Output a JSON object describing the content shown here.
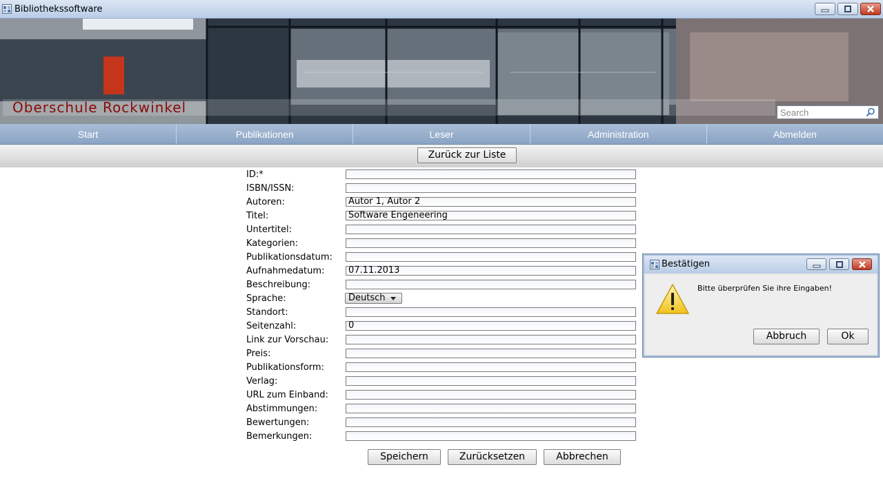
{
  "window": {
    "title": "Bibliothekssoftware"
  },
  "banner": {
    "school_name": "Oberschule Rockwinkel",
    "search_placeholder": "Search"
  },
  "nav": {
    "items": [
      "Start",
      "Publikationen",
      "Leser",
      "Administration",
      "Abmelden"
    ]
  },
  "subbar": {
    "back_label": "Zurück zur Liste"
  },
  "form": {
    "fields": [
      {
        "label": "ID:*",
        "value": ""
      },
      {
        "label": "ISBN/ISSN:",
        "value": ""
      },
      {
        "label": "Autoren:",
        "value": "Autor 1, Autor 2"
      },
      {
        "label": "Titel:",
        "value": "Software Engeneering"
      },
      {
        "label": "Untertitel:",
        "value": ""
      },
      {
        "label": "Kategorien:",
        "value": ""
      },
      {
        "label": "Publikationsdatum:",
        "value": ""
      },
      {
        "label": "Aufnahmedatum:",
        "value": "07.11.2013"
      },
      {
        "label": "Beschreibung:",
        "value": ""
      },
      {
        "label": "Sprache:",
        "value": "Deutsch"
      },
      {
        "label": "Standort:",
        "value": ""
      },
      {
        "label": "Seitenzahl:",
        "value": "0"
      },
      {
        "label": "Link zur Vorschau:",
        "value": ""
      },
      {
        "label": "Preis:",
        "value": ""
      },
      {
        "label": "Publikationsform:",
        "value": ""
      },
      {
        "label": "Verlag:",
        "value": ""
      },
      {
        "label": "URL zum Einband:",
        "value": ""
      },
      {
        "label": "Abstimmungen:",
        "value": ""
      },
      {
        "label": "Bewertungen:",
        "value": ""
      },
      {
        "label": "Bemerkungen:",
        "value": ""
      }
    ],
    "buttons": {
      "save": "Speichern",
      "reset": "Zurücksetzen",
      "cancel": "Abbrechen"
    }
  },
  "dialog": {
    "title": "Bestätigen",
    "message": "Bitte überprüfen Sie ihre Eingaben!",
    "cancel": "Abbruch",
    "ok": "Ok"
  }
}
